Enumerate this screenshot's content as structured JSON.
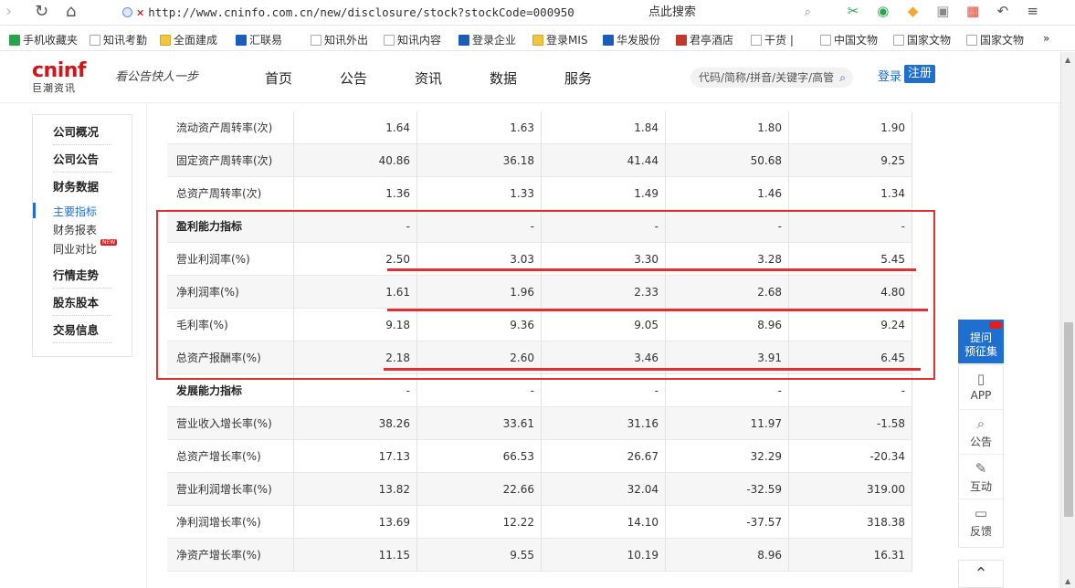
{
  "browser": {
    "url": "http://www.cninfo.com.cn/new/disclosure/stock?stockCode=000950",
    "search_placeholder": "点此搜索"
  },
  "bookmarks": [
    "手机收藏夹",
    "知讯考勤",
    "全面建成",
    "汇联易",
    "知讯外出",
    "知讯内容",
    "登录企业",
    "登录MIS",
    "华发股份",
    "君亭酒店",
    "干货 |",
    "中国文物",
    "国家文物",
    "国家文物",
    "»"
  ],
  "site": {
    "logo_text": "cninf",
    "logo_sub": "巨潮资讯",
    "slogan": "看公告快人一步",
    "nav": [
      "首页",
      "公告",
      "资讯",
      "数据",
      "服务"
    ],
    "search_placeholder": "代码/简称/拼音/关键字/高管",
    "login": "登录",
    "register": "注册"
  },
  "sidebar": {
    "items": [
      "公司概况",
      "公司公告",
      "财务数据",
      "行情走势",
      "股东股本",
      "交易信息"
    ],
    "sub_items": [
      "主要指标",
      "财务报表",
      "同业对比"
    ],
    "new_badge": "NEW"
  },
  "table": {
    "rows": [
      {
        "label": "流动资产周转率(次)",
        "bold": false,
        "values": [
          "1.64",
          "1.63",
          "1.84",
          "1.80",
          "1.90"
        ]
      },
      {
        "label": "固定资产周转率(次)",
        "bold": false,
        "values": [
          "40.86",
          "36.18",
          "41.44",
          "50.68",
          "9.25"
        ]
      },
      {
        "label": "总资产周转率(次)",
        "bold": false,
        "values": [
          "1.36",
          "1.33",
          "1.49",
          "1.46",
          "1.34"
        ]
      },
      {
        "label": "盈利能力指标",
        "bold": true,
        "values": [
          "-",
          "-",
          "-",
          "-",
          "-"
        ]
      },
      {
        "label": "营业利润率(%)",
        "bold": false,
        "values": [
          "2.50",
          "3.03",
          "3.30",
          "3.28",
          "5.45"
        ]
      },
      {
        "label": "净利润率(%)",
        "bold": false,
        "values": [
          "1.61",
          "1.96",
          "2.33",
          "2.68",
          "4.80"
        ]
      },
      {
        "label": "毛利率(%)",
        "bold": false,
        "values": [
          "9.18",
          "9.36",
          "9.05",
          "8.96",
          "9.24"
        ]
      },
      {
        "label": "总资产报酬率(%)",
        "bold": false,
        "values": [
          "2.18",
          "2.60",
          "3.46",
          "3.91",
          "6.45"
        ]
      },
      {
        "label": "发展能力指标",
        "bold": true,
        "values": [
          "-",
          "-",
          "-",
          "-",
          "-"
        ]
      },
      {
        "label": "营业收入增长率(%)",
        "bold": false,
        "values": [
          "38.26",
          "33.61",
          "31.16",
          "11.97",
          "-1.58"
        ]
      },
      {
        "label": "总资产增长率(%)",
        "bold": false,
        "values": [
          "17.13",
          "66.53",
          "26.67",
          "32.29",
          "-20.34"
        ]
      },
      {
        "label": "营业利润增长率(%)",
        "bold": false,
        "values": [
          "13.82",
          "22.66",
          "32.04",
          "-32.59",
          "319.00"
        ]
      },
      {
        "label": "净利润增长率(%)",
        "bold": false,
        "values": [
          "13.69",
          "12.22",
          "14.10",
          "-37.57",
          "318.38"
        ]
      },
      {
        "label": "净资产增长率(%)",
        "bold": false,
        "values": [
          "11.15",
          "9.55",
          "10.19",
          "8.96",
          "16.31"
        ]
      }
    ]
  },
  "float_panel": {
    "top_label_1": "提问",
    "top_label_2": "预征集",
    "items": [
      "APP",
      "公告",
      "互动",
      "反馈"
    ]
  },
  "colors": {
    "accent": "#1e6fce",
    "brand_red": "#d0161b",
    "annotation": "#e03030"
  }
}
